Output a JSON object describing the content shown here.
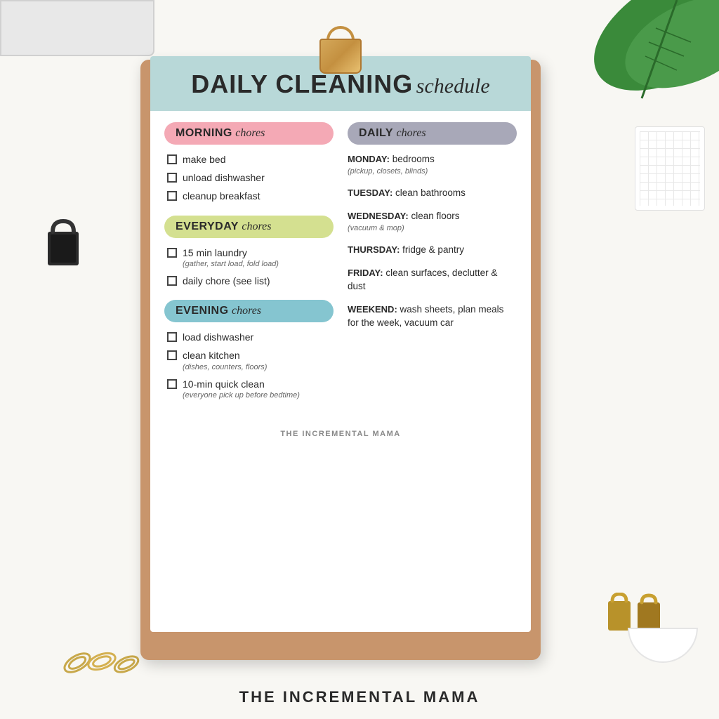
{
  "page": {
    "background_color": "#f8f7f3",
    "bottom_text": "THE INCREMENTAL MAMA"
  },
  "clipboard": {
    "header": {
      "title_bold": "DAILY CLEANING",
      "title_italic": "schedule",
      "bg_color": "#b8d8d8"
    },
    "morning": {
      "label_bold": "MORNING",
      "label_italic": "chores",
      "bg_color": "#f4a9b5",
      "items": [
        {
          "text": "make bed",
          "sub": ""
        },
        {
          "text": "unload dishwasher",
          "sub": ""
        },
        {
          "text": "cleanup breakfast",
          "sub": ""
        }
      ]
    },
    "everyday": {
      "label_bold": "EVERYDAY",
      "label_italic": "chores",
      "bg_color": "#d4e090",
      "items": [
        {
          "text": "15 min laundry",
          "sub": "(gather, start load, fold load)"
        },
        {
          "text": "daily chore (see list)",
          "sub": ""
        }
      ]
    },
    "evening": {
      "label_bold": "EVENING",
      "label_italic": "chores",
      "bg_color": "#85c5d0",
      "items": [
        {
          "text": "load dishwasher",
          "sub": ""
        },
        {
          "text": "clean kitchen",
          "sub": "(dishes, counters, floors)"
        },
        {
          "text": "10-min quick clean",
          "sub": "(everyone pick up before bedtime)"
        }
      ]
    },
    "daily": {
      "label_bold": "DAILY",
      "label_italic": "chores",
      "bg_color": "#a8a8b8",
      "items": [
        {
          "day": "MONDAY:",
          "text": "bedrooms",
          "sub": "(pickup, closets, blinds)"
        },
        {
          "day": "TUESDAY:",
          "text": "clean bathrooms",
          "sub": ""
        },
        {
          "day": "WEDNESDAY:",
          "text": "clean floors",
          "sub": "(vacuum & mop)"
        },
        {
          "day": "THURSDAY:",
          "text": "fridge & pantry",
          "sub": ""
        },
        {
          "day": "FRIDAY:",
          "text": "clean surfaces, declutter & dust",
          "sub": ""
        },
        {
          "day": "WEEKEND:",
          "text": "wash sheets, plan meals for the week, vacuum car",
          "sub": ""
        }
      ]
    },
    "footer": "THE INCREMENTAL MAMA"
  }
}
